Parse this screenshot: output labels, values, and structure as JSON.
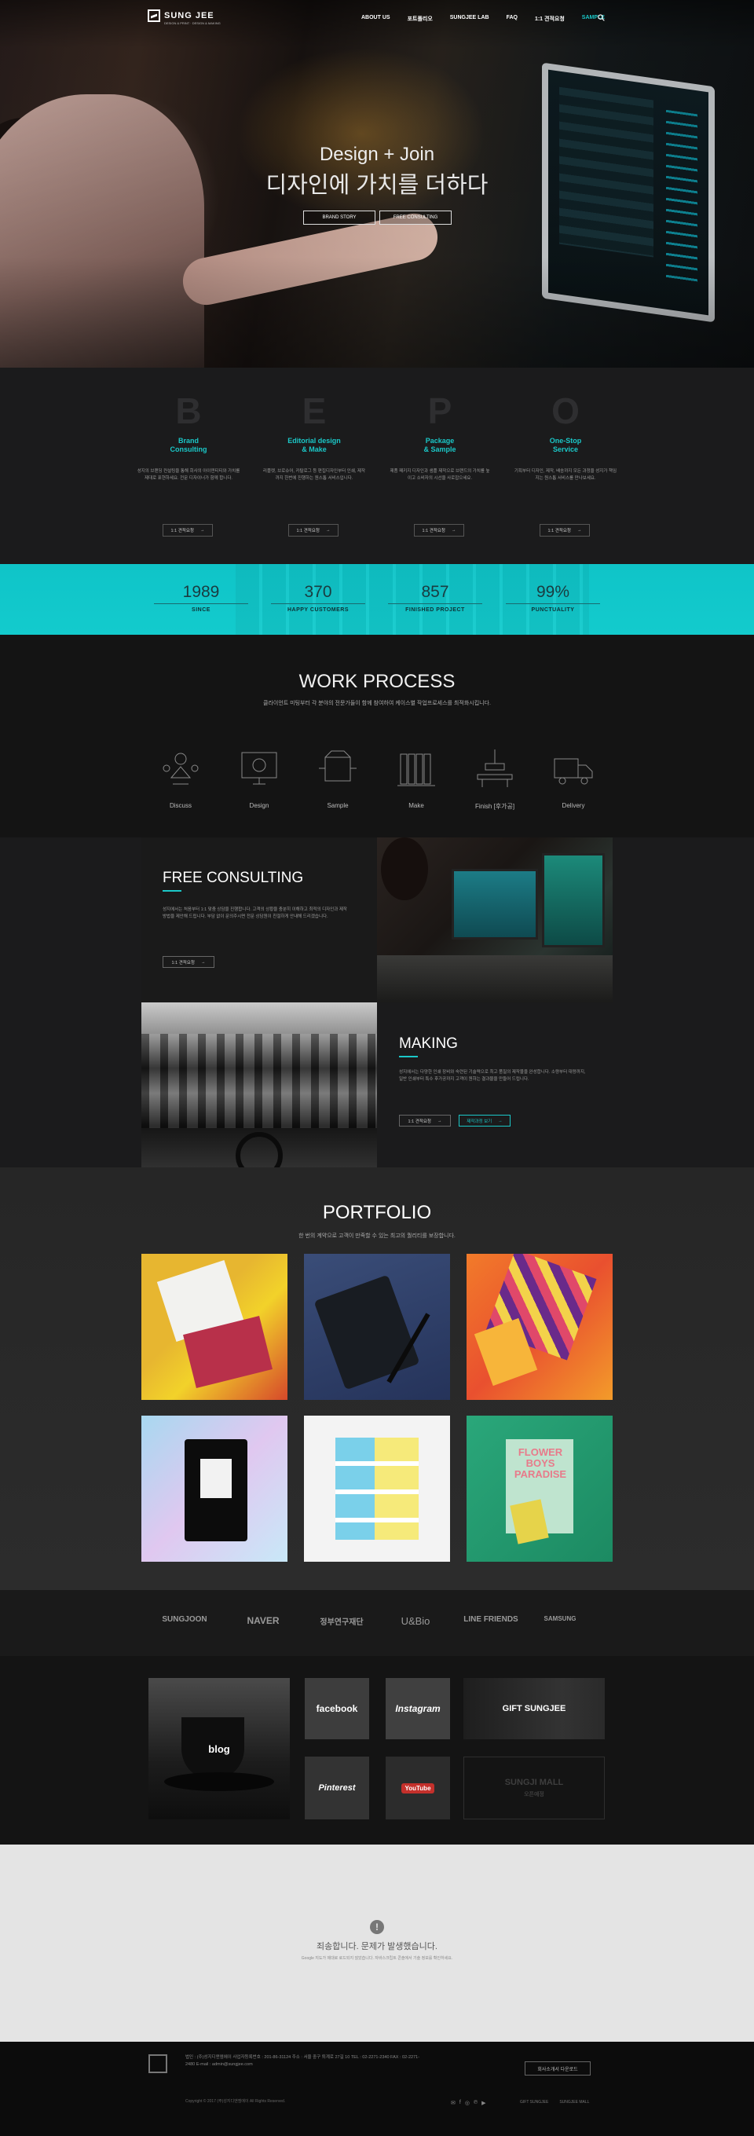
{
  "header": {
    "logo_text": "SUNG JEE",
    "logo_sub": "DESIGN & PRINT  ·  DESIGN & MAKING",
    "nav": [
      "ABOUT US",
      "포트폴리오",
      "SUNGJEE LAB",
      "FAQ",
      "1:1 견적요청",
      "SAMPLE"
    ],
    "active_index": 5
  },
  "hero": {
    "headline_en": "Design + Join",
    "headline_ko": "디자인에 가치를 더하다",
    "btn_story": "BRAND STORY",
    "btn_consult": "FREE CONSULTING"
  },
  "bepo": [
    {
      "letter": "B",
      "title": "Brand\nConsulting",
      "desc": "성지의 브랜딩 컨설팅을 통해 회사의 아이덴티티와 가치를 제대로 표현하세요. 전문 디자이너가 함께 합니다.",
      "btn": "1:1 견적요청"
    },
    {
      "letter": "E",
      "title": "Editorial design\n& Make",
      "desc": "리플렛, 브로슈어, 카탈로그 등 편집디자인부터 인쇄, 제작까지 한번에 진행하는 원스톱 서비스입니다.",
      "btn": "1:1 견적요청"
    },
    {
      "letter": "P",
      "title": "Package\n& Sample",
      "desc": "제품 패키지 디자인과 샘플 제작으로 브랜드의 가치를 높이고 소비자의 시선을 사로잡으세요.",
      "btn": "1:1 견적요청"
    },
    {
      "letter": "O",
      "title": "One-Stop\nService",
      "desc": "기획부터 디자인, 제작, 배송까지 모든 과정을 성지가 책임지는 원스톱 서비스를 만나보세요.",
      "btn": "1:1 견적요청"
    }
  ],
  "stats": [
    {
      "num": "1989",
      "label": "SINCE"
    },
    {
      "num": "370",
      "label": "HAPPY CUSTOMERS"
    },
    {
      "num": "857",
      "label": "FINISHED PROJECT"
    },
    {
      "num": "99%",
      "label": "PUNCTUALITY"
    }
  ],
  "work": {
    "title": "WORK PROCESS",
    "subtitle": "클라이언트 미팅부터 각 분야의 전문가들이 함께 참여하여 케이스별 작업프로세스를 최적화시킵니다.",
    "steps": [
      "Discuss",
      "Design",
      "Sample",
      "Make",
      "Finish [후가공]",
      "Delivery"
    ]
  },
  "consulting": {
    "title": "FREE CONSULTING",
    "desc": "성지에서는 처음부터 1:1 맞춤 상담을 진행합니다. 고객의 상황을 충분히 이해하고 최적의 디자인과 제작 방법을 제안해 드립니다. 부담 없이 문의주시면 전문 상담원이 친절하게 안내해 드리겠습니다.",
    "btn": "1:1 견적요청"
  },
  "making": {
    "title": "MAKING",
    "desc": "성지에서는 다양한 인쇄 장비와 숙련된 기술력으로 최고 품질의 제작물을 완성합니다. 소량부터 대량까지, 일반 인쇄부터 특수 후가공까지 고객이 원하는 결과물을 만들어 드립니다.",
    "btn1": "1:1 견적요청",
    "btn2": "제작과정 보기"
  },
  "portfolio": {
    "title": "PORTFOLIO",
    "subtitle": "한 번의 계약으로 고객이 만족할 수 있는 최고의 퀄리티를 보장합니다.",
    "flower_text": "FLOWER BOYS PARADISE"
  },
  "partners": [
    "SUNGJOON",
    "NAVER",
    "정부연구재단",
    "U&Bio",
    "LINE FRIENDS",
    "SAMSUNG"
  ],
  "sns": {
    "blog": "blog",
    "facebook": "facebook",
    "instagram": "Instagram",
    "gift": "GIFT SUNGJEE",
    "pinterest": "Pinterest",
    "youtube": "YouTube",
    "mall": "SUNGJI MALL",
    "mall_sub": "오픈예정"
  },
  "error": {
    "icon": "!",
    "title": "죄송합니다. 문제가 발생했습니다.",
    "subtitle": "Google 지도가 제대로 로드되지 않았습니다. 자바스크립트 콘솔에서 기술 정보를 확인하세요."
  },
  "footer": {
    "info": "법인 : (주)성지디앤엠에이  사업자등록번호 : 201-86-31124  주소 : 서울 중구 퇴계로 27길 10  TEL : 02-2271-2340  FAX : 02-2271-2480  E-mail : admin@sungjee.com",
    "copyright": "Copyright © 2017 (주)성지디앤엠에이 All Rights Reserved.",
    "btn": "회사소개서 다운로드",
    "links": [
      "GIFT SUNGJEE",
      "SUNGJEE MALL"
    ]
  },
  "colors": {
    "accent": "#1bc8c8",
    "bg_dark": "#1b1b1c"
  }
}
